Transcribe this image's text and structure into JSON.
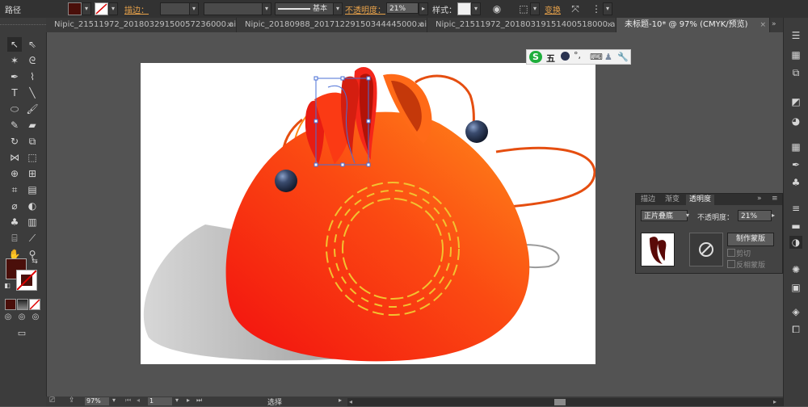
{
  "control_bar": {
    "object_type": "路径",
    "stroke_label": "描边：",
    "stroke_profile": "基本",
    "opacity_label": "不透明度：",
    "opacity_value": "21%",
    "style_label": "样式：",
    "transform_label": "变换"
  },
  "tabs": [
    {
      "label": "Nipic_21511972_20180329150057236000.ai*..."
    },
    {
      "label": "Nipic_20180988_20171229150344445000.ai*..."
    },
    {
      "label": "Nipic_21511972_20180319151400518000.ai*..."
    },
    {
      "label": "未标题-10* @ 97% (CMYK/预览)"
    }
  ],
  "tab_close_glyph": "×",
  "ime": {
    "logo": "S",
    "mode": "五"
  },
  "transparency_panel": {
    "tabs": [
      "描边",
      "渐变",
      "透明度"
    ],
    "blend_mode": "正片叠底",
    "opacity_label": "不透明度：",
    "opacity_value": "21%",
    "make_mask_label": "制作蒙版",
    "clip_label": "剪切",
    "invert_mask_label": "反相蒙版"
  },
  "status_bar": {
    "zoom": "97%",
    "page": "1",
    "tool_name": "选择"
  },
  "colors": {
    "fill": "#4a0f0a",
    "panel_bg": "#434343",
    "app_bg": "#535353",
    "accent_orange": "#e8a24a",
    "selection_blue": "#4a6fd6"
  },
  "icons": {
    "tools": [
      "selection-tool",
      "direct-selection-tool",
      "magic-wand-tool",
      "lasso-tool",
      "pen-tool",
      "curvature-tool",
      "type-tool",
      "line-tool",
      "rectangle-tool",
      "paintbrush-tool",
      "pencil-tool",
      "eraser-tool",
      "rotate-tool",
      "scale-tool",
      "width-tool",
      "free-transform-tool",
      "shape-builder-tool",
      "perspective-tool",
      "mesh-tool",
      "gradient-tool",
      "eyedropper-tool",
      "blend-tool",
      "symbol-sprayer-tool",
      "column-graph-tool",
      "artboard-tool",
      "slice-tool",
      "hand-tool",
      "zoom-tool"
    ]
  }
}
